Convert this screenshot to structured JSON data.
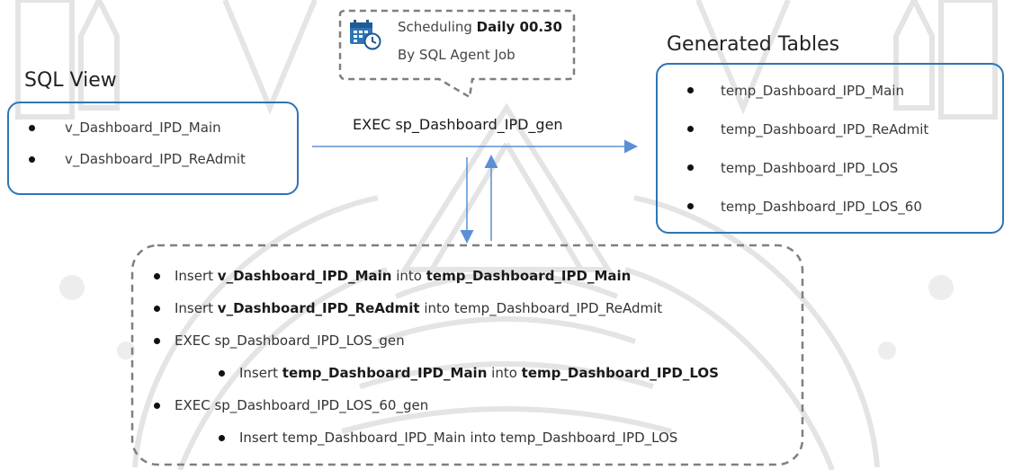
{
  "sql_view": {
    "title": "SQL View",
    "items": [
      "v_Dashboard_IPD_Main",
      "v_Dashboard_IPD_ReAdmit"
    ]
  },
  "schedule": {
    "line1_prefix": "Scheduling ",
    "line1_bold": "Daily 00.30",
    "line2": "By SQL Agent Job"
  },
  "exec_main": "EXEC sp_Dashboard_IPD_gen",
  "generated": {
    "title": "Generated Tables",
    "items": [
      "temp_Dashboard_IPD_Main",
      "temp_Dashboard_IPD_ReAdmit",
      "temp_Dashboard_IPD_LOS",
      "temp_Dashboard_IPD_LOS_60"
    ]
  },
  "steps": {
    "s1": {
      "a": "Insert ",
      "b": "v_Dashboard_IPD_Main",
      "c": " into ",
      "d": "temp_Dashboard_IPD_Main"
    },
    "s2": {
      "a": "Insert ",
      "b": "v_Dashboard_IPD_ReAdmit",
      "c": " into temp_Dashboard_IPD_ReAdmit"
    },
    "s3": "EXEC sp_Dashboard_IPD_LOS_gen",
    "s3a": {
      "a": "Insert ",
      "b": "temp_Dashboard_IPD_Main",
      "c": " into ",
      "d": "temp_Dashboard_IPD_LOS"
    },
    "s4": "EXEC sp_Dashboard_IPD_LOS_60_gen",
    "s4a": "Insert temp_Dashboard_IPD_Main into temp_Dashboard_IPD_LOS"
  },
  "colors": {
    "accent": "#2e75b6",
    "arrow": "#5b8fd6",
    "dashed_border": "#7f7f7f",
    "watermark": "#d9d9d9"
  },
  "icons": [
    "calendar-clock-icon"
  ]
}
